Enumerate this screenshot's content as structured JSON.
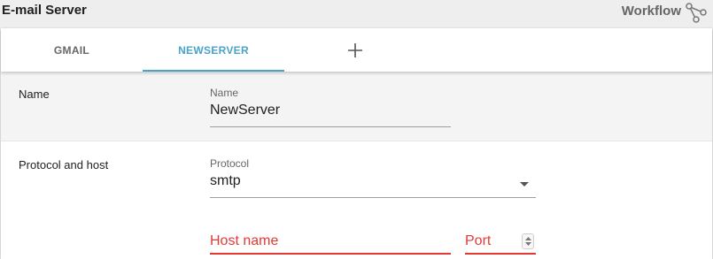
{
  "header": {
    "title": "E-mail Server",
    "workflow_label": "Workflow"
  },
  "tabs": [
    {
      "label": "GMAIL",
      "active": false
    },
    {
      "label": "NEWSERVER",
      "active": true
    }
  ],
  "add_tab_icon": "plus-icon",
  "sections": {
    "name": {
      "label": "Name",
      "field_caption": "Name",
      "field_value": "NewServer"
    },
    "protocol_host": {
      "label": "Protocol and host",
      "protocol_caption": "Protocol",
      "protocol_value": "smtp",
      "host_placeholder": "Host name",
      "port_placeholder": "Port"
    }
  },
  "colors": {
    "accent": "#4aa3c9",
    "error": "#e53935",
    "section_bg": "#f4f4f4"
  }
}
